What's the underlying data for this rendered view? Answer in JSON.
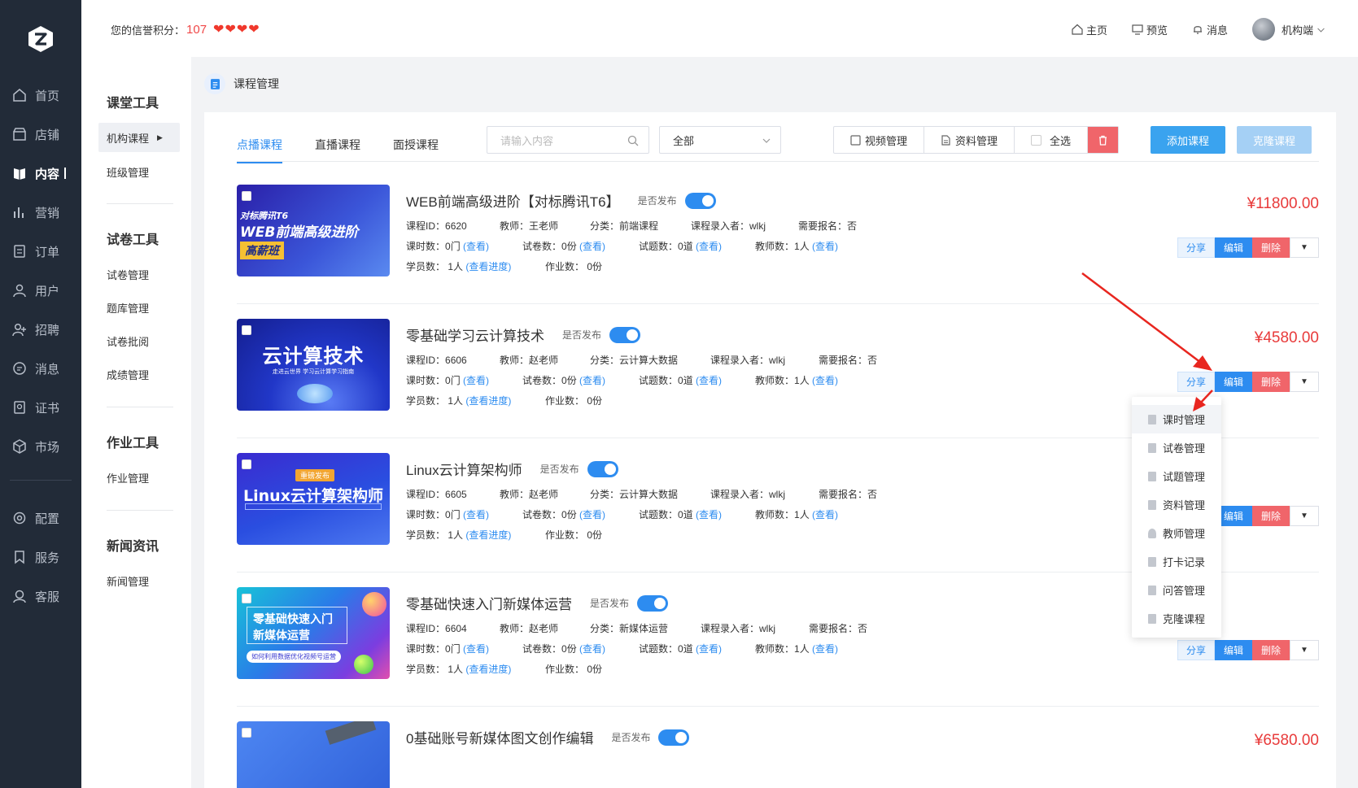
{
  "sidebar": {
    "items": [
      {
        "label": "首页",
        "icon": "home-icon"
      },
      {
        "label": "店铺",
        "icon": "store-icon"
      },
      {
        "label": "内容",
        "icon": "book-icon"
      },
      {
        "label": "营销",
        "icon": "chart-icon"
      },
      {
        "label": "订单",
        "icon": "order-icon"
      },
      {
        "label": "用户",
        "icon": "user-icon"
      },
      {
        "label": "招聘",
        "icon": "recruit-icon"
      },
      {
        "label": "消息",
        "icon": "message-icon"
      },
      {
        "label": "证书",
        "icon": "certificate-icon"
      },
      {
        "label": "市场",
        "icon": "market-icon"
      },
      {
        "label": "配置",
        "icon": "settings-icon"
      },
      {
        "label": "服务",
        "icon": "service-icon"
      },
      {
        "label": "客服",
        "icon": "support-icon"
      }
    ]
  },
  "header": {
    "credit_label": "您的信誉积分：",
    "credit_score": "107",
    "links": {
      "home": "主页",
      "preview": "预览",
      "message": "消息",
      "account": "机构端"
    }
  },
  "subnav": {
    "groups": [
      {
        "title": "课堂工具",
        "items": [
          "机构课程",
          "班级管理"
        ]
      },
      {
        "title": "试卷工具",
        "items": [
          "试卷管理",
          "题库管理",
          "试卷批阅",
          "成绩管理"
        ]
      },
      {
        "title": "作业工具",
        "items": [
          "作业管理"
        ]
      },
      {
        "title": "新闻资讯",
        "items": [
          "新闻管理"
        ]
      }
    ]
  },
  "breadcrumb": "课程管理",
  "toolbar": {
    "tabs": [
      "点播课程",
      "直播课程",
      "面授课程"
    ],
    "search_placeholder": "请输入内容",
    "select_value": "全部",
    "video_mgmt": "视频管理",
    "material_mgmt": "资料管理",
    "select_all": "全选",
    "add_course": "添加课程",
    "clone_course": "克隆课程"
  },
  "labels": {
    "published": "是否发布",
    "course_id": "课程ID：",
    "teacher": "教师：",
    "category": "分类：",
    "entered_by": "课程录入者：",
    "need_signup": "需要报名：",
    "lessons": "课时数：",
    "papers": "试卷数：",
    "questions": "试题数：",
    "teachers_count": "教师数：",
    "students": "学员数：",
    "homework": "作业数：",
    "view": "(查看)",
    "view_progress": "(查看进度)",
    "share": "分享",
    "edit": "编辑",
    "delete": "删除"
  },
  "courses": [
    {
      "title": "WEB前端高级进阶【对标腾讯T6】",
      "id": "6620",
      "teacher": "王老师",
      "category": "前端课程",
      "entered_by": "wlkj",
      "need_signup": "否",
      "lessons": "0门",
      "papers": "0份",
      "questions": "0道",
      "teachers_count": "1人",
      "students": "1人",
      "homework": "0份",
      "price": "¥11800.00",
      "thumb_lines": [
        "对标腾讯T6",
        "WEB前端高级进阶",
        "高薪班"
      ]
    },
    {
      "title": "零基础学习云计算技术",
      "id": "6606",
      "teacher": "赵老师",
      "category": "云计算大数据",
      "entered_by": "wlkj",
      "need_signup": "否",
      "lessons": "0门",
      "papers": "0份",
      "questions": "0道",
      "teachers_count": "1人",
      "students": "1人",
      "homework": "0份",
      "price": "¥4580.00",
      "thumb_lines": [
        "云计算技术",
        "走进云世界 学习云计算学习指南"
      ]
    },
    {
      "title": "Linux云计算架构师",
      "id": "6605",
      "teacher": "赵老师",
      "category": "云计算大数据",
      "entered_by": "wlkj",
      "need_signup": "否",
      "lessons": "0门",
      "papers": "0份",
      "questions": "0道",
      "teachers_count": "1人",
      "students": "1人",
      "homework": "0份",
      "price": "",
      "thumb_lines": [
        "重磅发布",
        "Linux云计算架构师"
      ]
    },
    {
      "title": "零基础快速入门新媒体运营",
      "id": "6604",
      "teacher": "赵老师",
      "category": "新媒体运营",
      "entered_by": "wlkj",
      "need_signup": "否",
      "lessons": "0门",
      "papers": "0份",
      "questions": "0道",
      "teachers_count": "1人",
      "students": "1人",
      "homework": "0份",
      "price": "",
      "thumb_lines": [
        "零基础快速入门",
        "新媒体运营",
        "如何利用数据优化视频号运营"
      ]
    },
    {
      "title": "0基础账号新媒体图文创作编辑",
      "price": "¥6580.00"
    }
  ],
  "dropdown": [
    "课时管理",
    "试卷管理",
    "试题管理",
    "资料管理",
    "教师管理",
    "打卡记录",
    "问答管理",
    "克隆课程"
  ],
  "colors": {
    "accent": "#2d8cf0",
    "danger": "#f0656a",
    "price": "#e83a3a",
    "sidebar": "#222b38"
  }
}
